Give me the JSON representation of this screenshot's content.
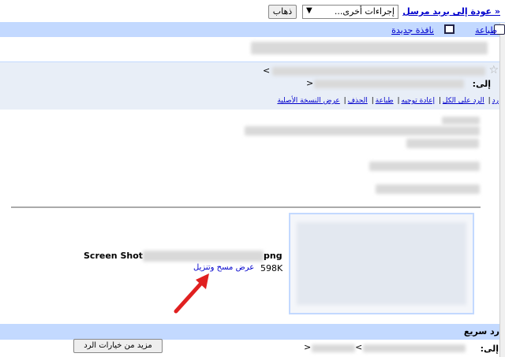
{
  "toolbar": {
    "back_label": "« عودة إلى بريد مرسل",
    "more_actions": "إجراءات أخرى...",
    "go_label": "ذهاب"
  },
  "actions": {
    "print_label": "طباعة",
    "new_window_label": "نافذة جديدة"
  },
  "message": {
    "to_label": "إلى:",
    "from_caret": "<",
    "to_caret": ">",
    "reply_links": [
      "رد",
      "الرد على الكل",
      "إعادة توجيه",
      "طباعة",
      "الحذف",
      "عرض النسخة الأصلية"
    ]
  },
  "attachment": {
    "name_start": "Screen Shot",
    "name_end": "png",
    "size": "598K",
    "links": "عرض مسح وتنزيل"
  },
  "quick_reply": {
    "title": "رد سريع",
    "to_label": "إلى:",
    "more_options": "مزيد من خيارات الرد"
  }
}
